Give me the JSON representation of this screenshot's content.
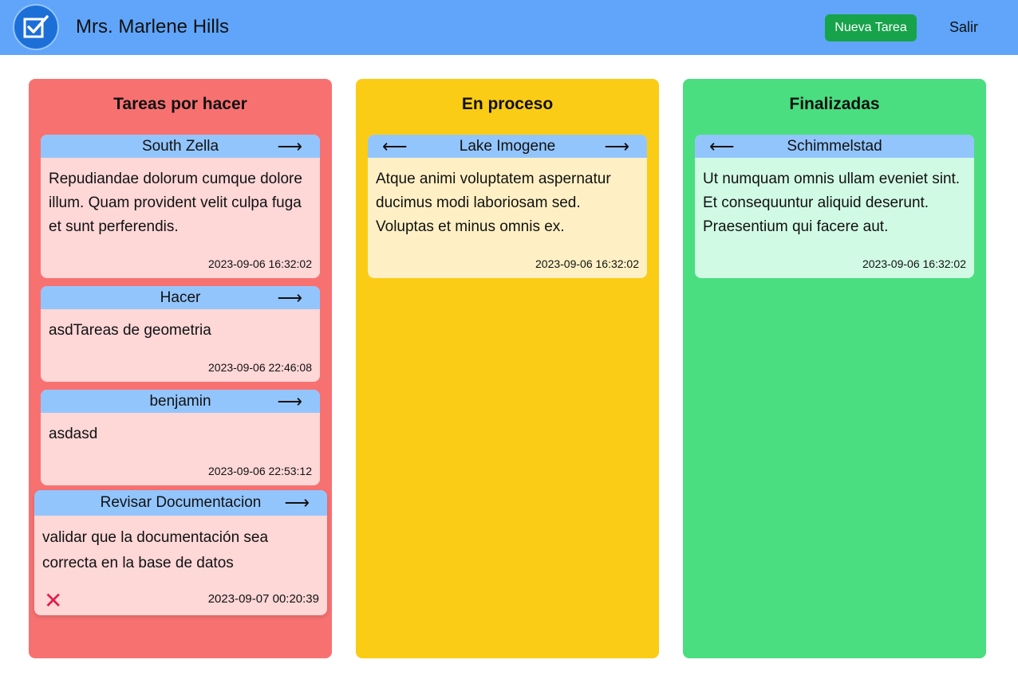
{
  "header": {
    "logo_icon": "checkbox-icon",
    "user_name": "Mrs. Marlene Hills",
    "new_task_label": "Nueva Tarea",
    "logout_label": "Salir"
  },
  "columns": {
    "todo": {
      "title": "Tareas por hacer",
      "color": "#f87171",
      "cards": [
        {
          "title": "South Zella",
          "body": "Repudiandae dolorum cumque dolore illum. Quam provident velit culpa fuga et sunt perferendis.",
          "date": "2023-09-06 16:32:02"
        },
        {
          "title": "Hacer",
          "body": "asdTareas de geometria",
          "date": "2023-09-06 22:46:08"
        },
        {
          "title": "benjamin",
          "body": "asdasd",
          "date": "2023-09-06 22:53:12"
        },
        {
          "title": "Revisar Documentacion",
          "body": "validar que la documentación sea correcta en la base de datos",
          "date": "2023-09-07 00:20:39"
        }
      ]
    },
    "progress": {
      "title": "En proceso",
      "color": "#facc15",
      "cards": [
        {
          "title": "Lake Imogene",
          "body": "Atque animi voluptatem aspernatur ducimus modi laboriosam sed. Voluptas et minus omnis ex.",
          "date": "2023-09-06 16:32:02"
        }
      ]
    },
    "done": {
      "title": "Finalizadas",
      "color": "#4ade80",
      "cards": [
        {
          "title": "Schimmelstad",
          "body": "Ut numquam omnis ullam eveniet sint. Et consequuntur aliquid deserunt. Praesentium qui facere aut.",
          "date": "2023-09-06 16:32:02"
        }
      ]
    }
  },
  "icons": {
    "arrow_right": "⟶",
    "arrow_left": "⟵",
    "delete": "✕"
  }
}
